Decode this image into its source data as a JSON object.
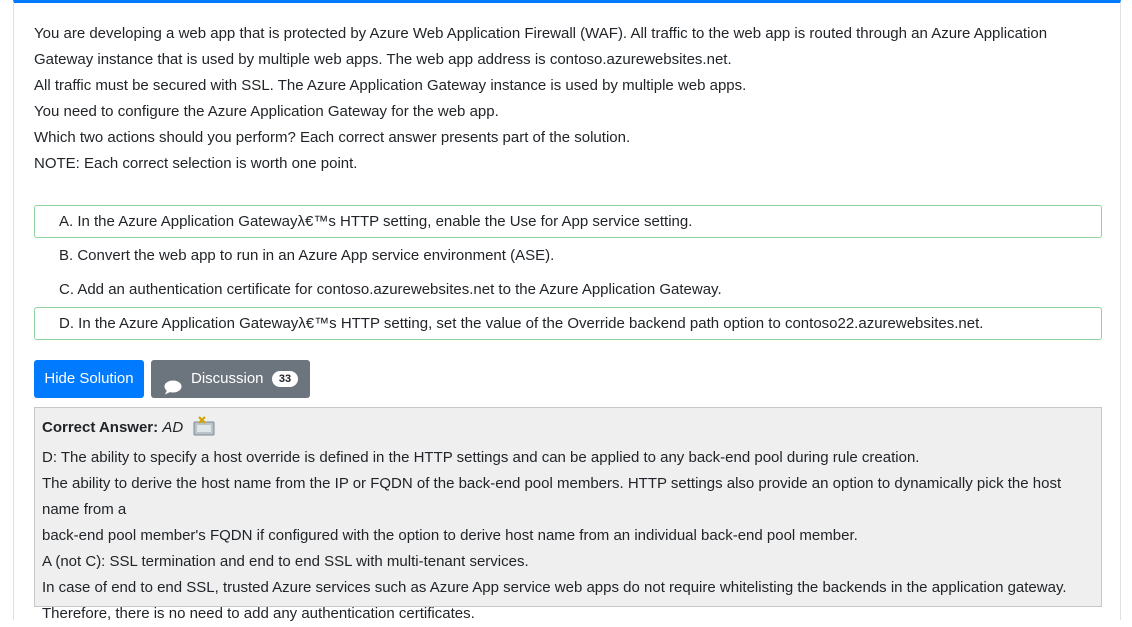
{
  "question": {
    "lines": [
      "You are developing a web app that is protected by Azure Web Application Firewall (WAF). All traffic to the web app is routed through an Azure Application",
      "Gateway instance that is used by multiple web apps. The web app address is contoso.azurewebsites.net.",
      "All traffic must be secured with SSL. The Azure Application Gateway instance is used by multiple web apps.",
      "You need to configure the Azure Application Gateway for the web app.",
      "Which two actions should you perform? Each correct answer presents part of the solution.",
      "NOTE: Each correct selection is worth one point."
    ]
  },
  "choices": [
    {
      "text": "A. In the Azure Application Gatewayλ€™s HTTP setting, enable the Use for App service setting.",
      "correct": true
    },
    {
      "text": "B. Convert the web app to run in an Azure App service environment (ASE).",
      "correct": false
    },
    {
      "text": "C. Add an authentication certificate for contoso.azurewebsites.net to the Azure Application Gateway.",
      "correct": false
    },
    {
      "text": "D. In the Azure Application Gatewayλ€™s HTTP setting, set the value of the Override backend path option to contoso22.azurewebsites.net.",
      "correct": true
    }
  ],
  "buttons": {
    "hide_solution": "Hide Solution",
    "discussion": "Discussion",
    "discussion_count": "33"
  },
  "answer": {
    "label": "Correct Answer:",
    "value": "AD",
    "lines": [
      "D: The ability to specify a host override is defined in the HTTP settings and can be applied to any back-end pool during rule creation.",
      "The ability to derive the host name from the IP or FQDN of the back-end pool members. HTTP settings also provide an option to dynamically pick the host name from a",
      "back-end pool member's FQDN if configured with the option to derive host name from an individual back-end pool member.",
      "A (not C): SSL termination and end to end SSL with multi-tenant services.",
      "In case of end to end SSL, trusted Azure services such as Azure App service web apps do not require whitelisting the backends in the application gateway.",
      "Therefore, there is no need to add any authentication certificates."
    ]
  },
  "colors": {
    "primary": "#007bff",
    "secondary": "#6c757d",
    "correct_border": "#8fd19e",
    "answer_bg": "#efefef"
  }
}
